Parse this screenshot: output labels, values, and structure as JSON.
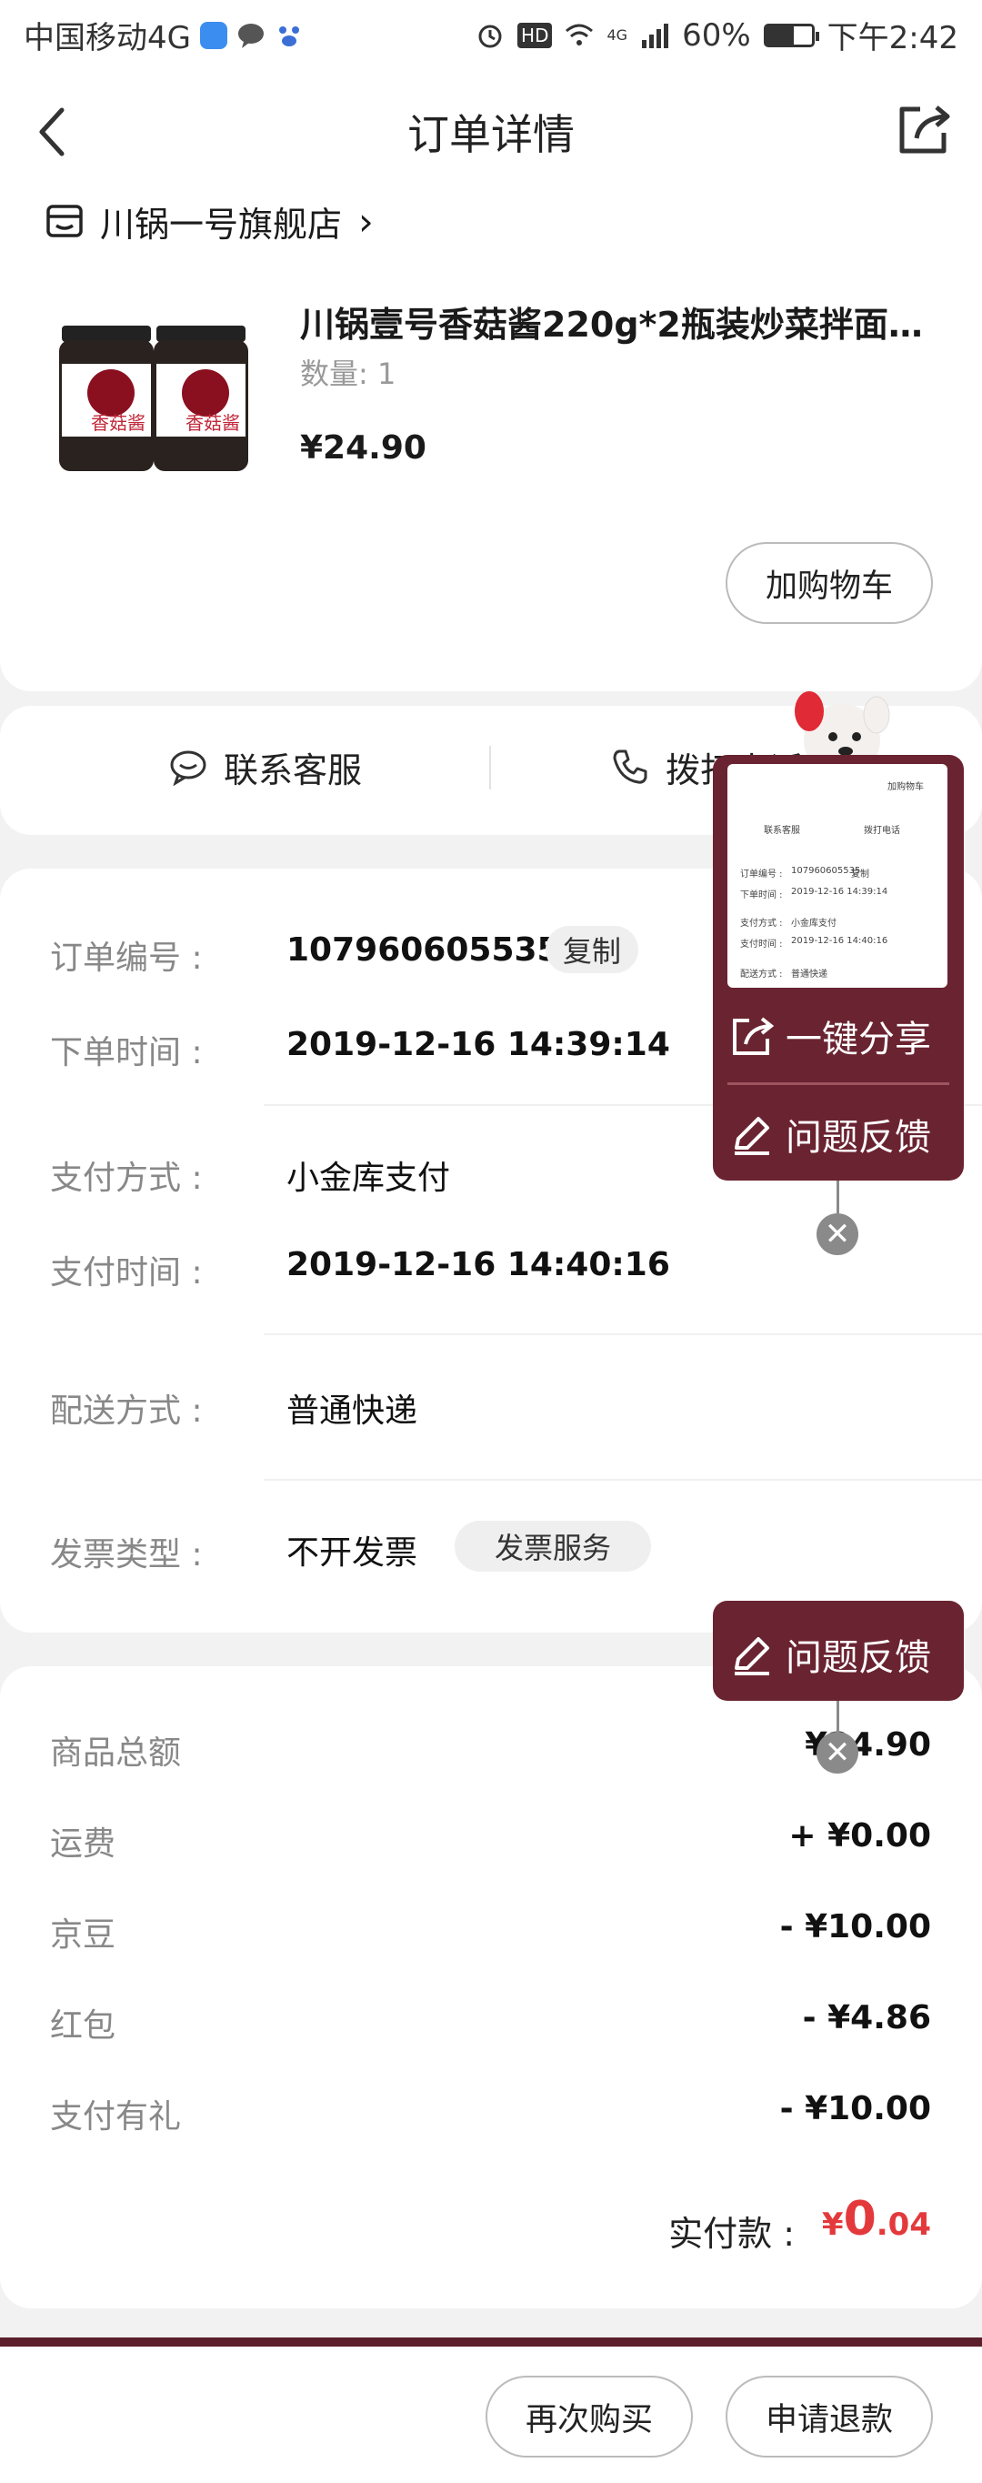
{
  "status_bar": {
    "carrier": "中国移动4G",
    "hd": "HD",
    "network": "4G",
    "battery_percent": "60%",
    "battery_level": 0.6,
    "time": "下午2:42"
  },
  "header": {
    "title": "订单详情"
  },
  "store": {
    "name": "川锅一号旗舰店",
    "chevron": "›"
  },
  "product": {
    "name": "川锅壹号香菇酱220g*2瓶装炒菜拌面…",
    "quantity_label": "数量: 1",
    "price": "¥24.90",
    "jar_label": "香菇酱",
    "add_cart_label": "加购物车"
  },
  "contact": {
    "service_label": "联系客服",
    "phone_label": "拨打电话"
  },
  "order_info": {
    "order_no_label": "订单编号 :",
    "order_no": "107960605535",
    "copy_label": "复制",
    "order_time_label": "下单时间 :",
    "order_time": "2019-12-16 14:39:14",
    "pay_method_label": "支付方式 :",
    "pay_method": "小金库支付",
    "pay_time_label": "支付时间 :",
    "pay_time": "2019-12-16 14:40:16",
    "delivery_label": "配送方式 :",
    "delivery": "普通快递",
    "invoice_label": "发票类型 :",
    "invoice": "不开发票",
    "invoice_service_label": "发票服务"
  },
  "amounts": {
    "goods_total_label": "商品总额",
    "goods_total": "¥24.90",
    "shipping_label": "运费",
    "shipping": "+ ¥0.00",
    "jingdou_label": "京豆",
    "jingdou": "- ¥10.00",
    "redpacket_label": "红包",
    "redpacket": "- ¥4.86",
    "pay_gift_label": "支付有礼",
    "pay_gift": "- ¥10.00",
    "paid_label": "实付款 :",
    "paid_currency": "¥",
    "paid_int": "0",
    "paid_dec": ".04"
  },
  "bottom": {
    "rebuy_label": "再次购买",
    "refund_label": "申请退款"
  },
  "floating": {
    "share_label": "一键分享",
    "feedback_label": "问题反馈",
    "feedback_label_2": "问题反馈",
    "close_symbol": "✕"
  }
}
